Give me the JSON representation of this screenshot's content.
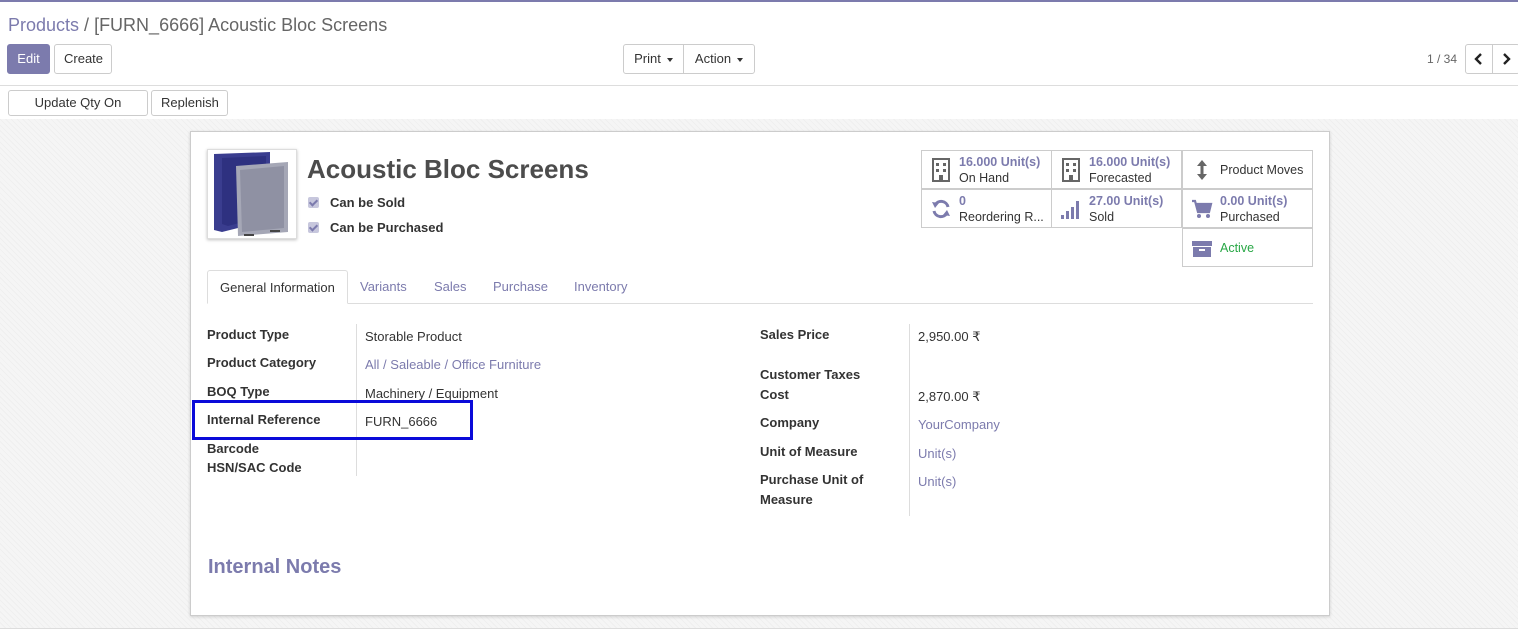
{
  "breadcrumb": {
    "parent": "Products",
    "separator": "/",
    "current": "[FURN_6666] Acoustic Bloc Screens"
  },
  "toolbar": {
    "edit_label": "Edit",
    "create_label": "Create",
    "print_label": "Print",
    "action_label": "Action",
    "pager": "1 / 34"
  },
  "actions": {
    "update_qty_label": "Update Qty On Hand",
    "replenish_label": "Replenish"
  },
  "product": {
    "name": "Acoustic Bloc Screens",
    "can_be_sold_label": "Can be Sold",
    "can_be_purchased_label": "Can be Purchased"
  },
  "stats": {
    "on_hand_value": "16.000 Unit(s)",
    "on_hand_label": "On Hand",
    "forecasted_value": "16.000 Unit(s)",
    "forecasted_label": "Forecasted",
    "product_moves_label": "Product Moves",
    "reordering_value": "0",
    "reordering_label": "Reordering R...",
    "sold_value": "27.00 Unit(s)",
    "sold_label": "Sold",
    "purchased_value": "0.00 Unit(s)",
    "purchased_label": "Purchased",
    "active_label": "Active"
  },
  "tabs": [
    "General Information",
    "Variants",
    "Sales",
    "Purchase",
    "Inventory"
  ],
  "left_fields": {
    "product_type_label": "Product Type",
    "product_type_value": "Storable Product",
    "product_category_label": "Product Category",
    "product_category_value": "All / Saleable / Office Furniture",
    "boq_type_label": "BOQ Type",
    "boq_type_value": "Machinery / Equipment",
    "internal_reference_label": "Internal Reference",
    "internal_reference_value": "FURN_6666",
    "barcode_label": "Barcode",
    "hsn_label": "HSN/SAC Code"
  },
  "right_fields": {
    "sales_price_label": "Sales Price",
    "sales_price_value": "2,950.00 ₹",
    "customer_taxes_label": "Customer Taxes",
    "cost_label": "Cost",
    "cost_value": "2,870.00 ₹",
    "company_label": "Company",
    "company_value": "YourCompany",
    "uom_label": "Unit of Measure",
    "uom_value": "Unit(s)",
    "purchase_uom_label_1": "Purchase Unit of",
    "purchase_uom_label_2": "Measure",
    "purchase_uom_value": "Unit(s)"
  },
  "notes": {
    "title": "Internal Notes"
  },
  "colors": {
    "accent": "#7c7bad",
    "active_green": "#28a745",
    "highlight_blue": "#0a0ad9"
  }
}
